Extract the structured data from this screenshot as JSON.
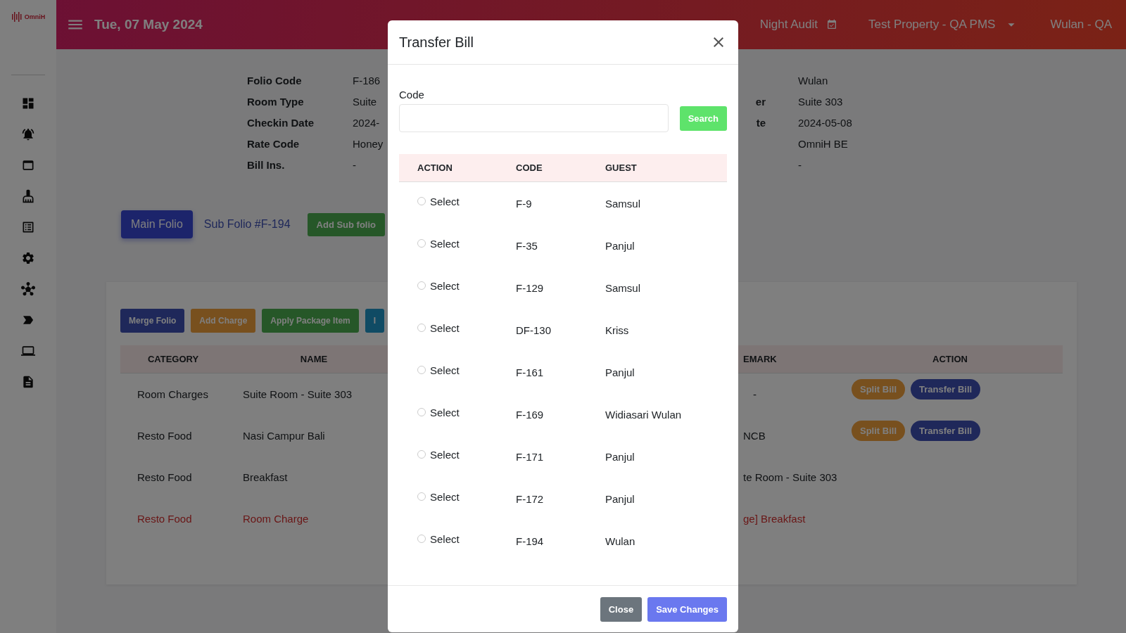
{
  "header": {
    "date": "Tue, 07 May 2024",
    "night_audit": "Night Audit",
    "property": "Test Property - QA PMS",
    "user": "Wulan - QA"
  },
  "sidebar": {
    "logo_text": "OmniH"
  },
  "folio_info": {
    "left": [
      {
        "label": "Folio Code",
        "value": "F-186"
      },
      {
        "label": "Room Type",
        "value": "Suite"
      },
      {
        "label": "Checkin Date",
        "value": "2024-"
      },
      {
        "label": "Rate Code",
        "value": "Honey"
      },
      {
        "label": "Bill Ins.",
        "value": "-"
      }
    ],
    "right": [
      {
        "value": "Wulan"
      },
      {
        "label": "er",
        "value": "Suite 303"
      },
      {
        "label": "te",
        "value": "2024-05-08"
      },
      {
        "value": "OmniH BE"
      },
      {
        "value": "-"
      }
    ]
  },
  "folio_tabs": [
    {
      "label": "Main Folio",
      "selected": true
    },
    {
      "label": "Sub Folio #F-194",
      "selected": false
    }
  ],
  "add_sub_folio": "Add Sub folio",
  "toolbar": [
    {
      "label": "Merge Folio",
      "kind": "primary"
    },
    {
      "label": "Add Charge",
      "kind": "warning"
    },
    {
      "label": "Apply Package Item",
      "kind": "success"
    },
    {
      "label": "I",
      "kind": "info"
    }
  ],
  "charges": {
    "columns": [
      "CATEGORY",
      "NAME",
      "EMARK",
      "ACTION"
    ],
    "rows": [
      {
        "category": "Room Charges",
        "name": "Suite Room - Suite 303",
        "remark": "-",
        "kind": "normal",
        "actions": [
          "Split Bill",
          "Transfer Bill"
        ]
      },
      {
        "category": "Resto Food",
        "name": "Nasi Campur Bali",
        "remark": "NCB",
        "kind": "normal",
        "actions": [
          "Split Bill",
          "Transfer Bill"
        ]
      },
      {
        "category": "Resto Food",
        "name": "Breakfast",
        "remark": "te Room - Suite 303",
        "kind": "normal"
      },
      {
        "category": "Resto Food",
        "name": "Room Charge",
        "remark": "ge] Breakfast",
        "kind": "alert"
      }
    ]
  },
  "modal": {
    "title": "Transfer Bill",
    "code_label": "Code",
    "search_button": "Search",
    "columns": [
      "ACTION",
      "CODE",
      "GUEST"
    ],
    "rows": [
      {
        "action": "Select",
        "code": "F-9",
        "guest": "Samsul",
        "selected": false
      },
      {
        "action": "Select",
        "code": "F-35",
        "guest": "Panjul",
        "selected": false
      },
      {
        "action": "Select",
        "code": "F-129",
        "guest": "Samsul",
        "selected": false
      },
      {
        "action": "Select",
        "code": "DF-130",
        "guest": "Kriss",
        "selected": false
      },
      {
        "action": "Select",
        "code": "F-161",
        "guest": "Panjul",
        "selected": false
      },
      {
        "action": "Select",
        "code": "F-169",
        "guest": "Widiasari Wulan",
        "selected": false
      },
      {
        "action": "Select",
        "code": "F-171",
        "guest": "Panjul",
        "selected": false
      },
      {
        "action": "Select",
        "code": "F-172",
        "guest": "Panjul",
        "selected": false
      },
      {
        "action": "Select",
        "code": "F-194",
        "guest": "Wulan",
        "selected": false
      }
    ],
    "buttons": [
      {
        "label": "Close",
        "kind": "secondary"
      },
      {
        "label": "Save Changes",
        "kind": "primary"
      }
    ]
  }
}
